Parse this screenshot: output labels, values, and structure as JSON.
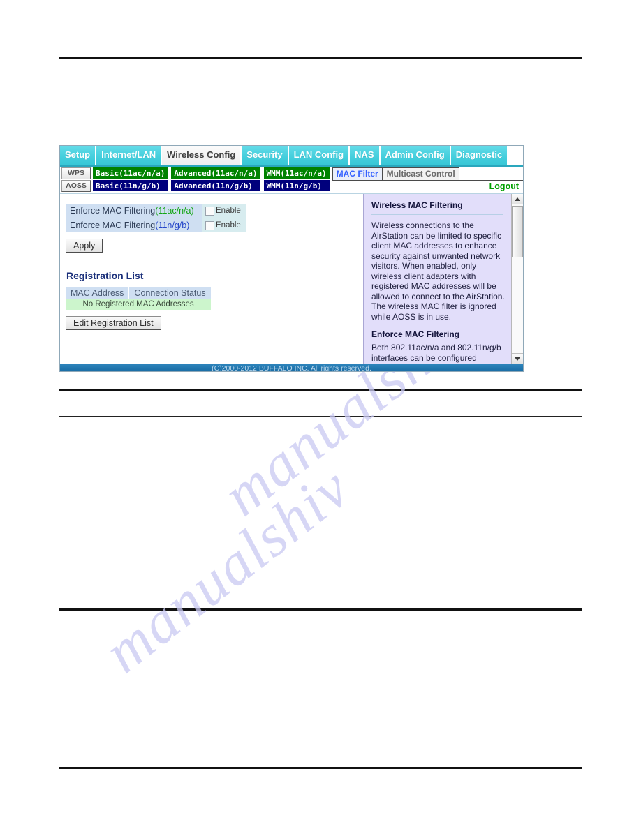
{
  "window": {
    "main_tabs": [
      {
        "label": "Setup",
        "active": false
      },
      {
        "label": "Internet/LAN",
        "active": false
      },
      {
        "label": "Wireless Config",
        "active": true
      },
      {
        "label": "Security",
        "active": false
      },
      {
        "label": "LAN Config",
        "active": false
      },
      {
        "label": "NAS",
        "active": false
      },
      {
        "label": "Admin Config",
        "active": false
      },
      {
        "label": "Diagnostic",
        "active": false
      }
    ],
    "side_buttons": [
      {
        "label": "WPS"
      },
      {
        "label": "AOSS"
      }
    ],
    "sub_tab_columns": [
      {
        "ac_label": "Basic(11ac/n/a)",
        "ngb_label": "Basic(11n/g/b)"
      },
      {
        "ac_label": "Advanced(11ac/n/a)",
        "ngb_label": "Advanced(11n/g/b)"
      },
      {
        "ac_label": "WMM(11ac/n/a)",
        "ngb_label": "WMM(11n/g/b)"
      }
    ],
    "filter_tabs": [
      {
        "label": "MAC Filter",
        "active": true
      },
      {
        "label": "Multicast Control",
        "active": false
      }
    ],
    "logout_label": "Logout",
    "footer": "(C)2000-2012 BUFFALO INC. All rights reserved."
  },
  "form": {
    "rows": [
      {
        "label_prefix": "Enforce MAC Filtering",
        "band": "(11ac/n/a)",
        "band_color": "#14a514",
        "checkbox_label": "Enable",
        "checked": false
      },
      {
        "label_prefix": "Enforce MAC Filtering",
        "band": "(11n/g/b)",
        "band_color": "#2546c8",
        "checkbox_label": "Enable",
        "checked": false
      }
    ],
    "apply_label": "Apply"
  },
  "registration": {
    "title": "Registration List",
    "columns": [
      "MAC Address",
      "Connection Status"
    ],
    "empty_message": "No Registered MAC Addresses",
    "edit_label": "Edit Registration List"
  },
  "help": {
    "heading_1": "Wireless MAC Filtering",
    "body_1": "Wireless connections to the AirStation can be limited to specific client MAC addresses to enhance security against unwanted network visitors. When enabled, only wireless client adapters with registered MAC addresses will be allowed to connect to the AirStation. The wireless MAC filter is ignored while AOSS is in use.",
    "heading_2": "Enforce MAC Filtering",
    "body_2": "Both 802.11ac/n/a and 802.11n/g/b interfaces can be configured"
  },
  "watermark": {
    "text_1": "manualshiv",
    "text_2": "manualshiv"
  },
  "colors": {
    "tab_cyan": "#45cfdd",
    "band_green": "#008200",
    "band_navy": "#00007c",
    "footer_blue": "#1b72ab",
    "help_lavender": "#e2defa"
  }
}
